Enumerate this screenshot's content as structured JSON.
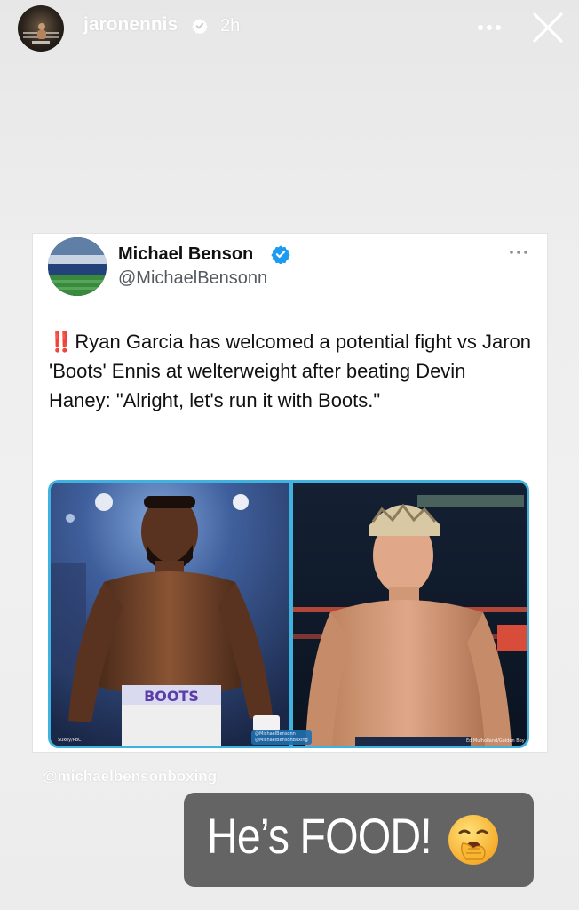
{
  "story": {
    "username": "jaronennis",
    "time": "2h",
    "mention": "@michaelbensonboxing",
    "caption": "He’s FOOD!",
    "caption_emoji": "yawning-face-emoji"
  },
  "tweet": {
    "author_name": "Michael Benson",
    "author_handle": "@MichaelBensonn",
    "bangs": "‼️",
    "text": "Ryan Garcia has welcomed a potential fight vs Jaron 'Boots' Ennis at welterweight after beating Devin Haney: \"Alright, let's run it with Boots.\"",
    "media_credit_left": "Sukey/PBC",
    "media_credit_center_1": "@MichaelBensonn",
    "media_credit_center_2": "@MichaelBensonBoxing",
    "media_credit_right": "Ed Mulholland/Golden Boy"
  },
  "colors": {
    "verified_blue": "#1d9bf0",
    "media_border": "#3fb2e0",
    "caption_bg": "#646464",
    "bangs": "#d62e2e"
  },
  "icons": [
    "verified-badge-icon",
    "more-options-icon",
    "close-icon",
    "verified-blue-badge-icon",
    "tweet-more-icon"
  ]
}
